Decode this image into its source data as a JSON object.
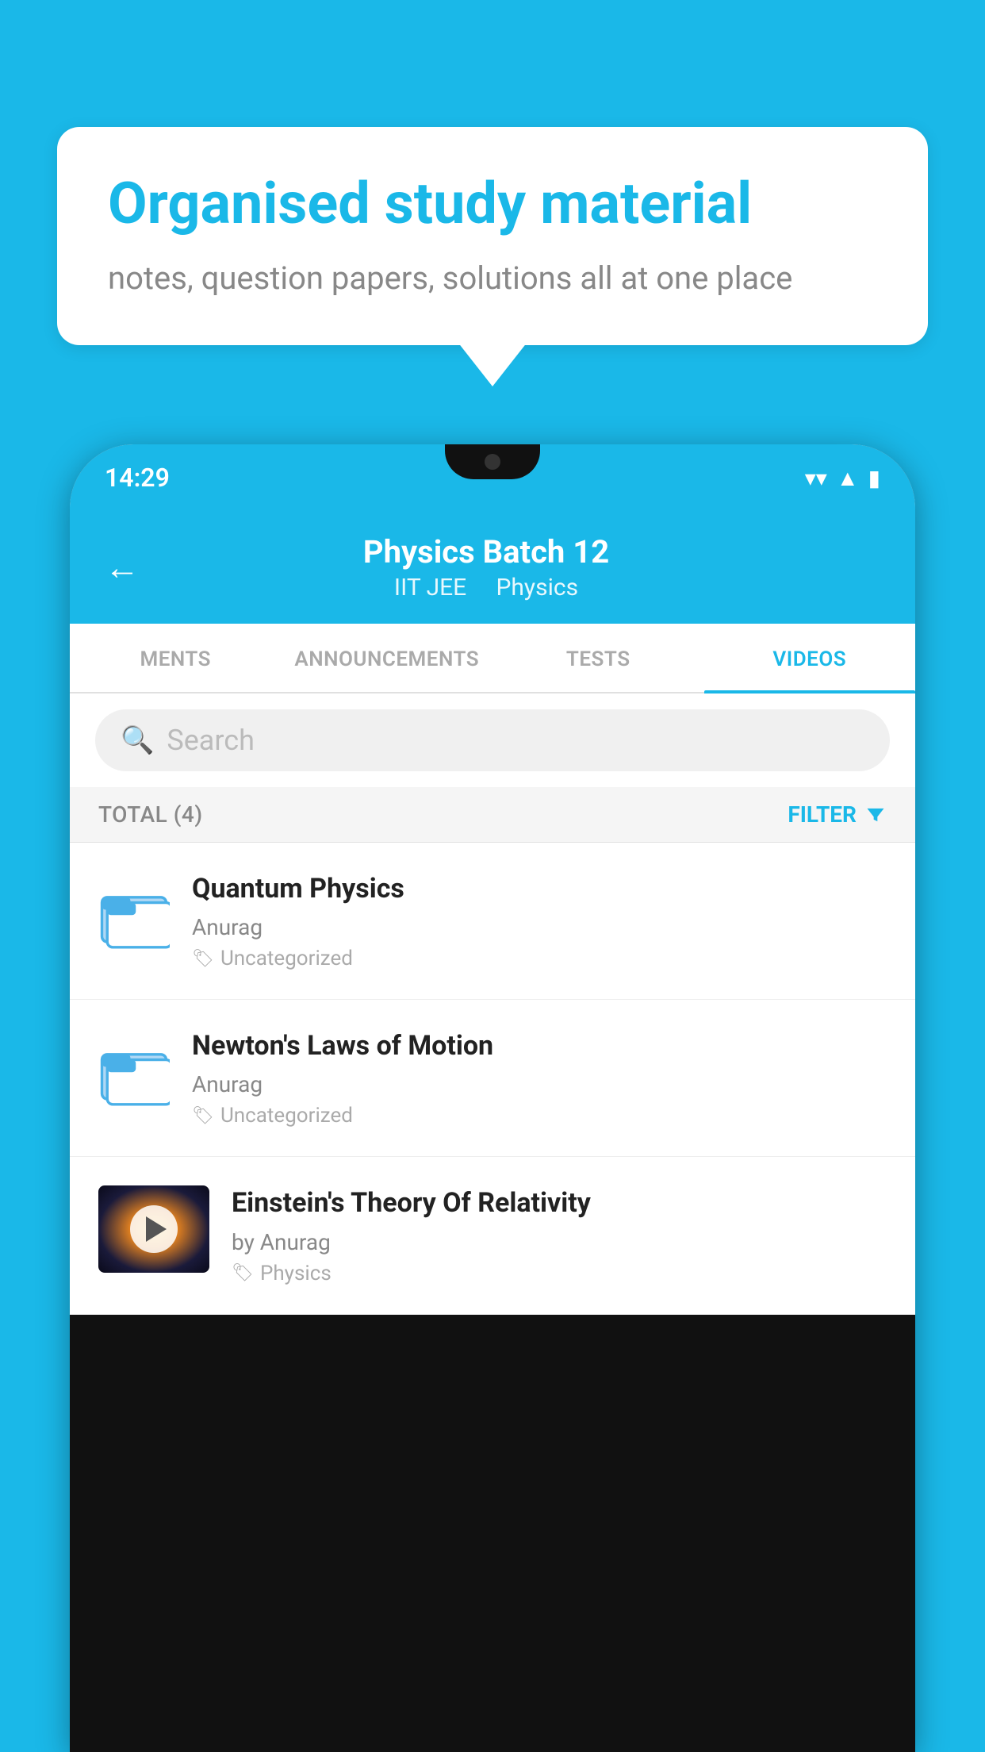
{
  "background_color": "#1ab8e8",
  "speech_bubble": {
    "heading": "Organised study material",
    "subtext": "notes, question papers, solutions all at one place"
  },
  "phone": {
    "status_bar": {
      "time": "14:29",
      "icons": [
        "wifi",
        "signal",
        "battery"
      ]
    },
    "app_header": {
      "back_label": "←",
      "title": "Physics Batch 12",
      "subtitle_tags": [
        "IIT JEE",
        "Physics"
      ]
    },
    "tabs": [
      {
        "label": "MENTS",
        "active": false
      },
      {
        "label": "ANNOUNCEMENTS",
        "active": false
      },
      {
        "label": "TESTS",
        "active": false
      },
      {
        "label": "VIDEOS",
        "active": true
      }
    ],
    "search": {
      "placeholder": "Search"
    },
    "filter_bar": {
      "total_label": "TOTAL (4)",
      "filter_label": "FILTER"
    },
    "video_items": [
      {
        "id": 1,
        "title": "Quantum Physics",
        "author": "Anurag",
        "tag": "Uncategorized",
        "has_thumbnail": false
      },
      {
        "id": 2,
        "title": "Newton's Laws of Motion",
        "author": "Anurag",
        "tag": "Uncategorized",
        "has_thumbnail": false
      },
      {
        "id": 3,
        "title": "Einstein's Theory Of Relativity",
        "author": "by Anurag",
        "tag": "Physics",
        "has_thumbnail": true
      }
    ]
  }
}
